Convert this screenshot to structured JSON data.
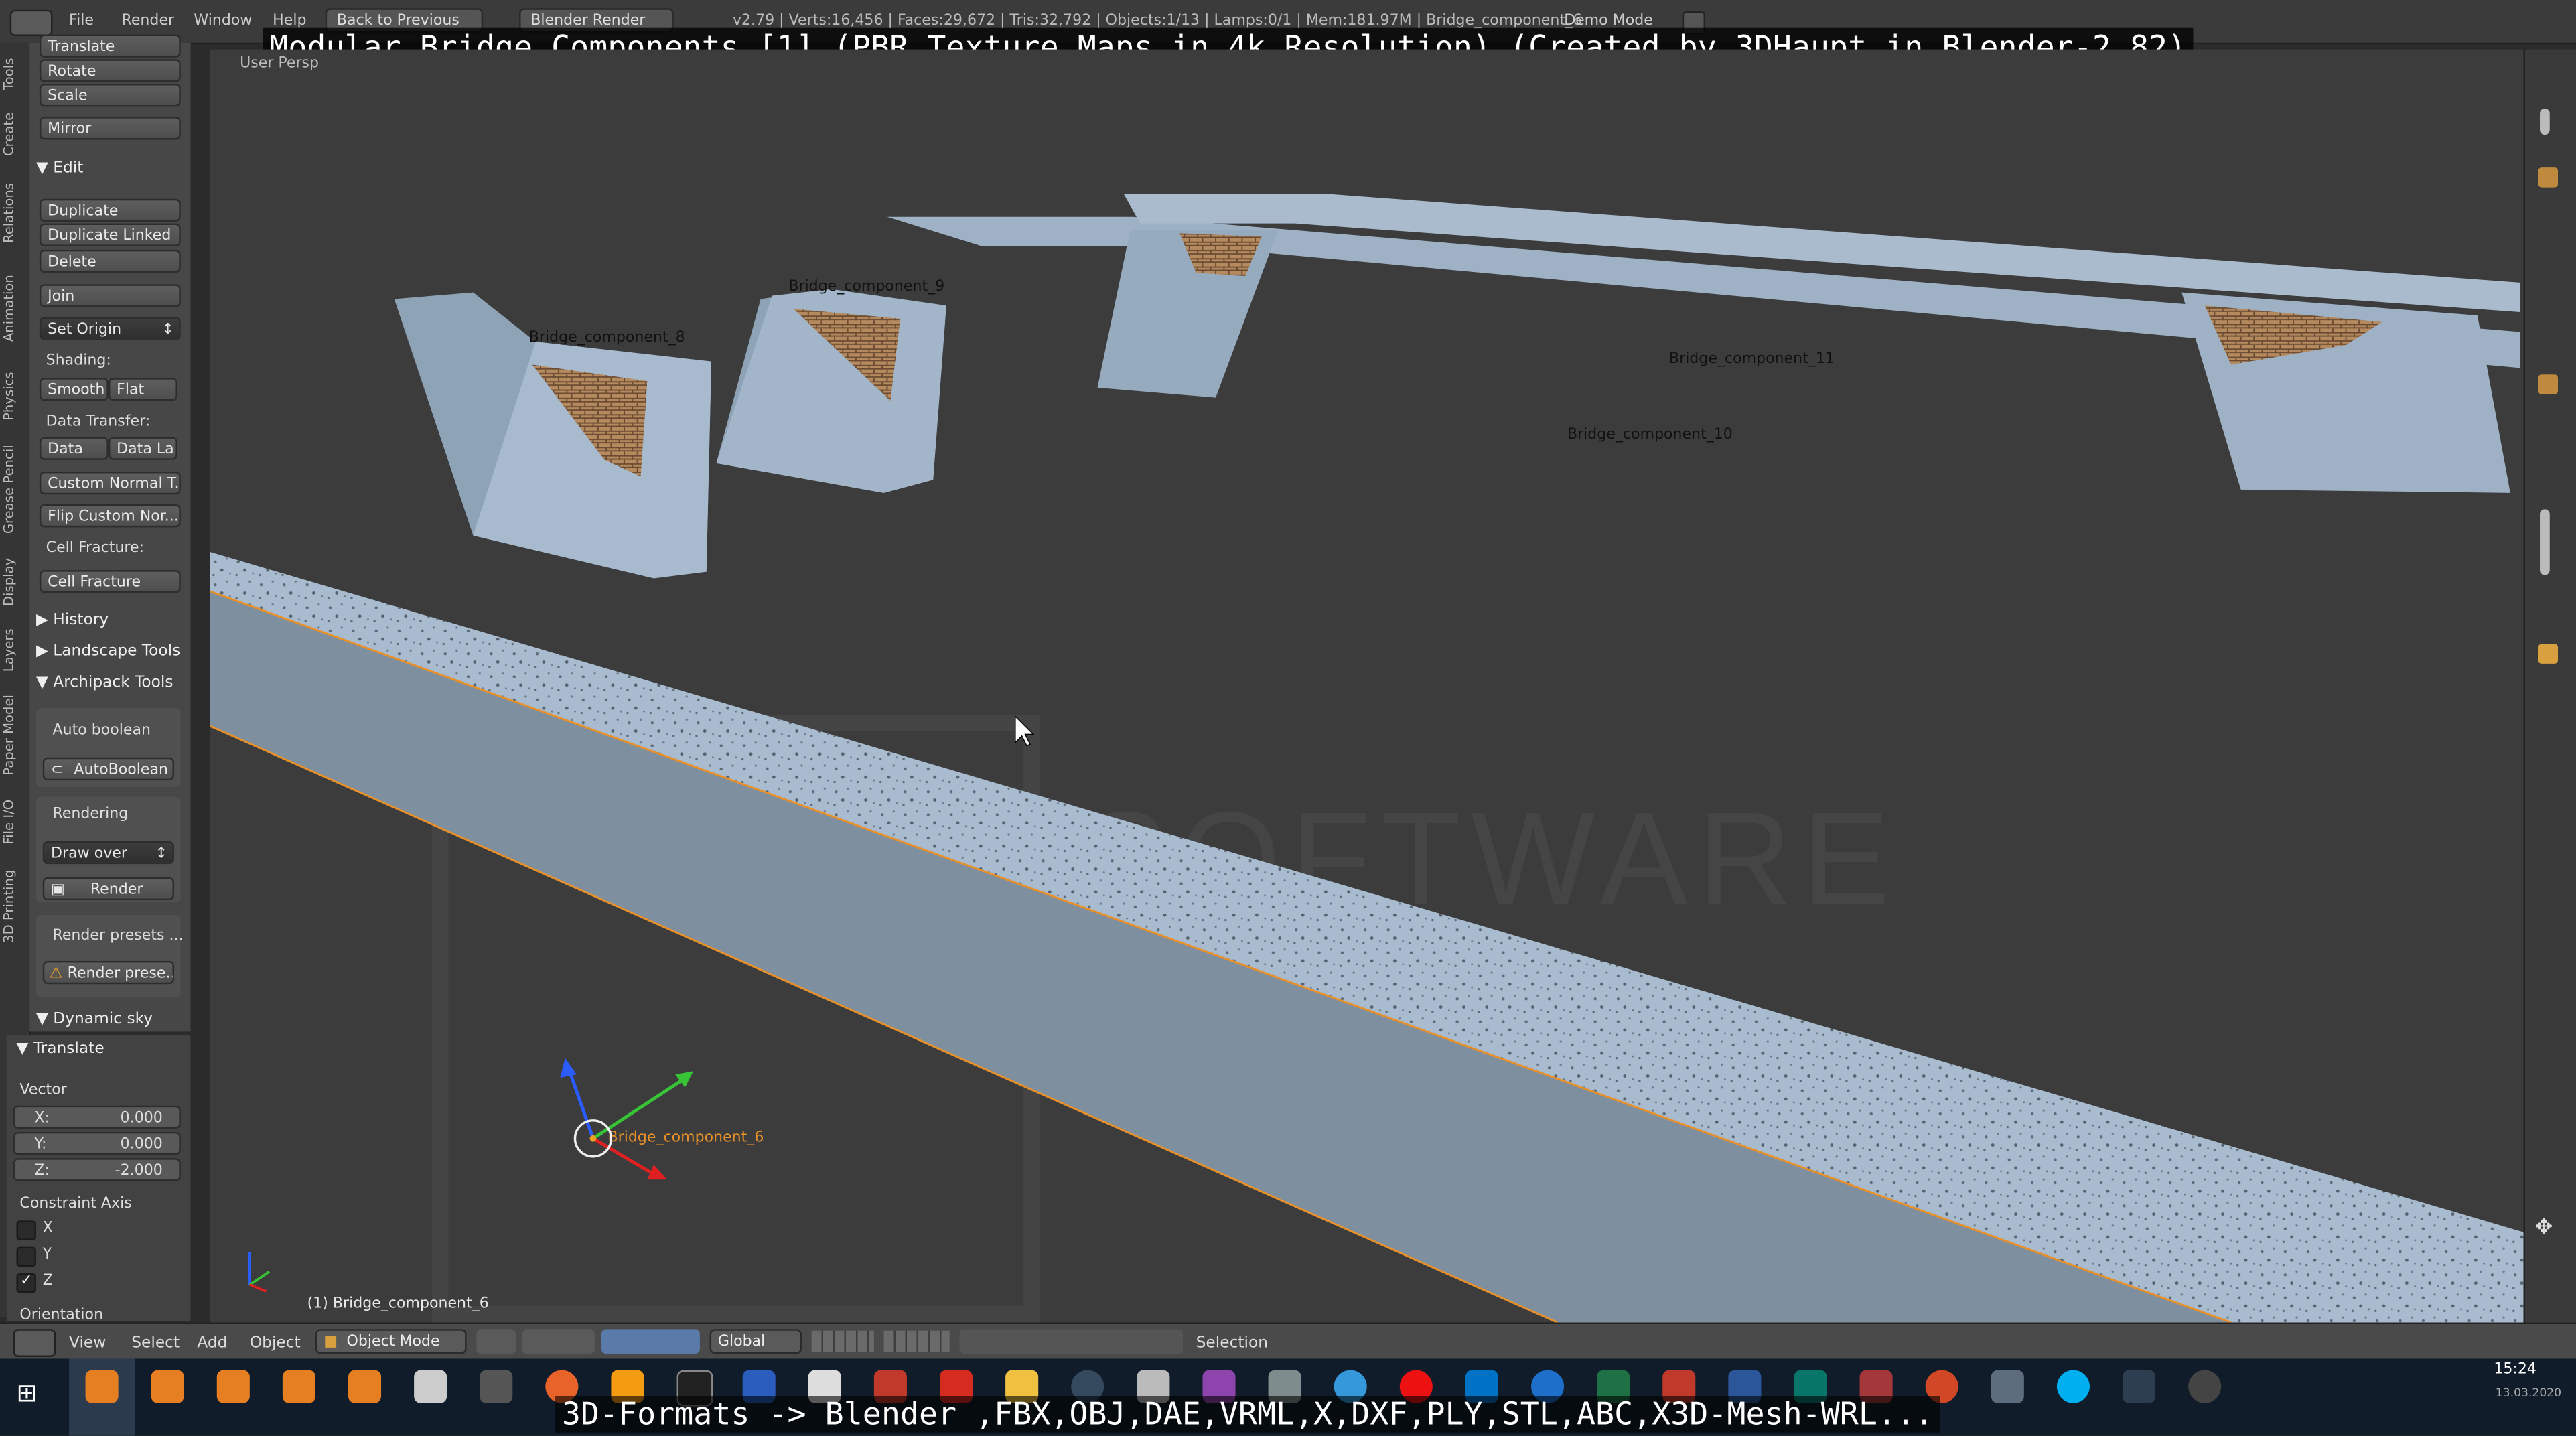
{
  "overlay": {
    "title": "Modular Bridge Components [1] (PBR Texture Maps in 4k Resolution) (Created by 3DHaupt in Blender-2.82)",
    "subtitle": "3D-Formats -> Blender ,FBX,OBJ,DAE,VRML,X,DXF,PLY,STL,ABC,X3D-Mesh-WRL..."
  },
  "topbar": {
    "menus": [
      "File",
      "Render",
      "Window",
      "Help"
    ],
    "back_button": "Back to Previous",
    "engine": "Blender Render",
    "stats": "v2.79 | Verts:16,456 | Faces:29,672 | Tris:32,792 | Objects:1/13 | Lamps:0/1 | Mem:181.97M | Bridge_component_6",
    "mode_label": "Demo Mode"
  },
  "vtabs": [
    "Tools",
    "Create",
    "Relations",
    "Animation",
    "Physics",
    "Grease Pencil",
    "Display",
    "Layers",
    "Paper Model",
    "File I/O",
    "3D Printing"
  ],
  "toolshelf": {
    "transform_buttons": [
      "Translate",
      "Rotate",
      "Scale",
      "Mirror"
    ],
    "edit_header": "Edit",
    "edit_buttons": [
      "Duplicate",
      "Duplicate Linked",
      "Delete"
    ],
    "join": "Join",
    "set_origin": "Set Origin",
    "shading_label": "Shading:",
    "smooth": "Smooth",
    "flat": "Flat",
    "data_transfer_label": "Data Transfer:",
    "data": "Data",
    "data_la": "Data La",
    "custom_normal": "Custom Normal T...",
    "flip_custom": "Flip Custom Nor...",
    "cell_fracture_label": "Cell Fracture:",
    "cell_fracture": "Cell Fracture",
    "history": "History",
    "landscape": "Landscape Tools",
    "archipack": "Archipack Tools",
    "auto_boolean_label": "Auto boolean",
    "auto_boolean": "AutoBoolean",
    "rendering_label": "Rendering",
    "draw_over": "Draw over",
    "render": "Render",
    "render_presets_label": "Render presets ...",
    "render_presets": "Render prese...",
    "dynamic_sky": "Dynamic sky"
  },
  "redo_panel": {
    "header": "Translate",
    "vector_label": "Vector",
    "fields": [
      {
        "axis": "X:",
        "value": "0.000"
      },
      {
        "axis": "Y:",
        "value": "0.000"
      },
      {
        "axis": "Z:",
        "value": "-2.000"
      }
    ],
    "constraint_label": "Constraint Axis",
    "constraints": [
      {
        "label": "X",
        "checked": false
      },
      {
        "label": "Y",
        "checked": false
      },
      {
        "label": "Z",
        "checked": true
      }
    ],
    "orientation_label": "Orientation"
  },
  "viewport": {
    "view_label": "User Persp",
    "object_labels": {
      "c8": "Bridge_component_8",
      "c9": "Bridge_component_9",
      "c11": "Bridge_component_11",
      "c10": "Bridge_component_10",
      "c6": "Bridge_component_6"
    },
    "selected_info": "(1) Bridge_component_6",
    "watermark": "SOFTWARE"
  },
  "bottombar": {
    "menus": [
      "View",
      "Select",
      "Add",
      "Object"
    ],
    "mode": "Object Mode",
    "orientation": "Global",
    "status": "Selection"
  },
  "taskbar": {
    "time": "15:24",
    "date": "13.03.2020"
  },
  "colors": {
    "selection_outline": "#e8902a",
    "concrete": "#9db0c2",
    "brick": "#b58a5e",
    "viewport_bg": "#3c3c3c"
  }
}
